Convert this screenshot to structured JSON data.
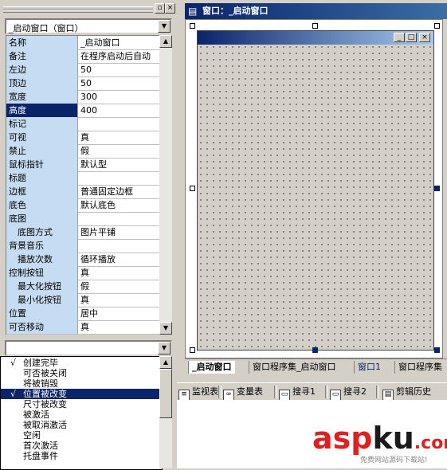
{
  "property_panel": {
    "object_selector": "_启动窗口（窗口）",
    "rows": [
      {
        "name": "名称",
        "value": "_启动窗口",
        "indent": false,
        "selected": false
      },
      {
        "name": "备注",
        "value": "在程序启动后自动",
        "indent": false,
        "selected": false
      },
      {
        "name": "左边",
        "value": "50",
        "indent": false,
        "selected": false
      },
      {
        "name": "顶边",
        "value": "50",
        "indent": false,
        "selected": false
      },
      {
        "name": "宽度",
        "value": "300",
        "indent": false,
        "selected": false
      },
      {
        "name": "高度",
        "value": "400",
        "indent": false,
        "selected": true
      },
      {
        "name": "标记",
        "value": "",
        "indent": false,
        "selected": false
      },
      {
        "name": "可视",
        "value": "真",
        "indent": false,
        "selected": false
      },
      {
        "name": "禁止",
        "value": "假",
        "indent": false,
        "selected": false
      },
      {
        "name": "鼠标指针",
        "value": "默认型",
        "indent": false,
        "selected": false
      },
      {
        "name": "标题",
        "value": "",
        "indent": false,
        "selected": false
      },
      {
        "name": "边框",
        "value": "普通固定边框",
        "indent": false,
        "selected": false
      },
      {
        "name": "底色",
        "value": "默认底色",
        "indent": false,
        "selected": false
      },
      {
        "name": "底图",
        "value": "",
        "indent": false,
        "selected": false
      },
      {
        "name": "底图方式",
        "value": "图片平铺",
        "indent": true,
        "selected": false
      },
      {
        "name": "背景音乐",
        "value": "",
        "indent": false,
        "selected": false
      },
      {
        "name": "播放次数",
        "value": "循环播放",
        "indent": true,
        "selected": false
      },
      {
        "name": "控制按钮",
        "value": "真",
        "indent": false,
        "selected": false
      },
      {
        "name": "最大化按钮",
        "value": "假",
        "indent": true,
        "selected": false
      },
      {
        "name": "最小化按钮",
        "value": "真",
        "indent": true,
        "selected": false
      },
      {
        "name": "位置",
        "value": "居中",
        "indent": false,
        "selected": false
      },
      {
        "name": "可否移动",
        "value": "真",
        "indent": false,
        "selected": false
      }
    ],
    "event_selector": "",
    "events": [
      {
        "check": "√",
        "label": "创建完毕",
        "selected": false
      },
      {
        "check": "",
        "label": "可否被关闭",
        "selected": false
      },
      {
        "check": "",
        "label": "将被销毁",
        "selected": false
      },
      {
        "check": "√",
        "label": "位置被改变",
        "selected": true
      },
      {
        "check": "",
        "label": "尺寸被改变",
        "selected": false
      },
      {
        "check": "",
        "label": "被激活",
        "selected": false
      },
      {
        "check": "",
        "label": "被取消激活",
        "selected": false
      },
      {
        "check": "",
        "label": "空闲",
        "selected": false
      },
      {
        "check": "",
        "label": "首次激活",
        "selected": false
      },
      {
        "check": "",
        "label": "托盘事件",
        "selected": false
      }
    ]
  },
  "designer": {
    "title": "窗口：_启动窗口",
    "icon": "window-designer-icon",
    "window_buttons": [
      "_",
      "□",
      "×"
    ]
  },
  "tabs": [
    {
      "label": "_启动窗口",
      "active": true
    },
    {
      "label": "窗口程序集_启动窗口",
      "active": false
    },
    {
      "label": "窗口1",
      "active": false
    },
    {
      "label": "窗口程序集",
      "active": false
    }
  ],
  "bottom_toolbar": [
    {
      "icon": "watch-icon",
      "label": "监视表"
    },
    {
      "icon": "variable-icon",
      "label": "变量表"
    },
    {
      "icon": "search-icon",
      "label": "搜寻1"
    },
    {
      "icon": "search-icon",
      "label": "搜寻2"
    },
    {
      "icon": "clipboard-icon",
      "label": "剪辑历史"
    }
  ],
  "watermark": {
    "brand_a": "asp",
    "brand_b": "ku",
    "brand_c": ".com",
    "sub": "免费网站源码下载站!"
  }
}
